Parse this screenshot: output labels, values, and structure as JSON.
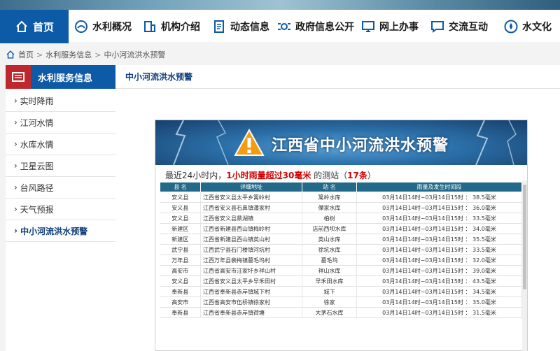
{
  "nav": {
    "home": "首页",
    "items": [
      "水利概况",
      "机构介绍",
      "动态信息",
      "政府信息公开",
      "网上办事",
      "交流互动",
      "水文化"
    ]
  },
  "breadcrumb": {
    "home": "首页",
    "sep1": ">",
    "section": "水利服务信息",
    "sep2": ">",
    "current": "中小河流洪水预警"
  },
  "sidebar": {
    "title": "水利服务信息",
    "items": [
      "实时降雨",
      "江河水情",
      "水库水情",
      "卫星云图",
      "台风路径",
      "天气预报",
      "中小河流洪水预警"
    ]
  },
  "content": {
    "title": "中小河流洪水预警"
  },
  "panel": {
    "banner_title": "江西省中小河流洪水预警",
    "subtitle": {
      "part1": "最近24小时内，",
      "part2": "1小时雨量超过30毫米",
      "part3": " 的测站（",
      "count": "17条",
      "part4": "）"
    },
    "columns": [
      "县  名",
      "详细地址",
      "站  名",
      "雨量及发生时间段"
    ],
    "rows": [
      [
        "安义县",
        "江西省安义县太平乡篱岭村",
        "篱岭水库",
        "03月14日14时~03月14日15时 ： 38.5毫米"
      ],
      [
        "安义县",
        "江西省安义县石鼻镇潘家村",
        "傈家水库",
        "03月14日14时~03月14日15时 ： 36.0毫米"
      ],
      [
        "安义县",
        "江西省安义县鼎湖镇",
        "柏树",
        "03月14日14时~03月14日15时 ： 33.5毫米"
      ],
      [
        "新建区",
        "江西省新建县西山镇梅岭村",
        "店前西坝水库",
        "03月14日14时~03月14日15时 ： 34.0毫米"
      ],
      [
        "新建区",
        "江西省新建县西山镇英山村",
        "英山水库",
        "03月14日14时~03月14日15时 ： 35.5毫米"
      ],
      [
        "武宁县",
        "江西武宁县石门楼镇河坑村",
        "徐坑水库",
        "03月14日14时~03月14日15时 ： 33.5毫米"
      ],
      [
        "万年县",
        "江西万年县裴梅镇墓毛坞村",
        "墓毛坞",
        "03月14日14时~03月14日15时 ： 32.0毫米"
      ],
      [
        "高安市",
        "江西省高安市汪家圩乡祥山村",
        "祥山水库",
        "03月14日14时~03月14日15时 ： 39.0毫米"
      ],
      [
        "安义县",
        "江西省安义县太平乡早禾田村",
        "早禾田水库",
        "03月14日14时~03月14日15时 ： 43.5毫米"
      ],
      [
        "奉新县",
        "江西省奉新县赤岸镇城下村",
        "城下",
        "03月14日14时~03月14日15时 ： 34.5毫米"
      ],
      [
        "高安市",
        "江西省高安市伍桥镇徐家村",
        "徐家",
        "03月14日14时~03月14日15时 ： 35.0毫米"
      ],
      [
        "奉新县",
        "江西省奉新县赤岸镇荷塘",
        "大茅石水库",
        "03月14日14时~03月14日15时 ： 31.5毫米"
      ]
    ]
  },
  "colors": {
    "primary": "#0d5aa6",
    "accent_red": "#c0272d",
    "header_teal": "#236a8a",
    "highlight": "#d00000"
  },
  "icons": [
    "home-icon",
    "water-drop-icon",
    "building-icon",
    "document-icon",
    "eye-icon",
    "monitor-icon",
    "chat-icon",
    "drop-circle-icon",
    "warning-icon",
    "newspaper-icon"
  ]
}
